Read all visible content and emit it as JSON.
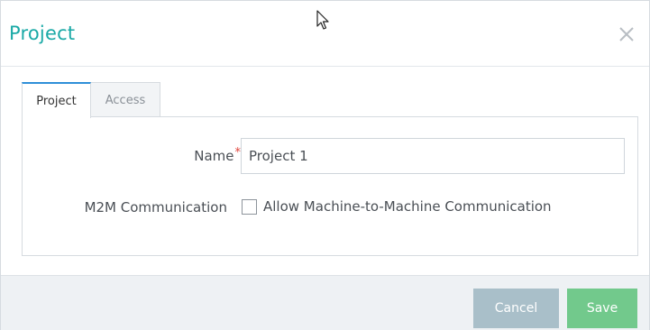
{
  "dialog": {
    "title": "Project",
    "close_icon": "close-icon"
  },
  "tabs": [
    {
      "label": "Project",
      "active": true
    },
    {
      "label": "Access",
      "active": false
    }
  ],
  "form": {
    "name_label": "Name",
    "required_marker": "*",
    "name_value": "Project 1",
    "m2m_label": "M2M Communication",
    "m2m_checkbox_label": "Allow Machine-to-Machine Communication",
    "m2m_checked": false
  },
  "footer": {
    "cancel_label": "Cancel",
    "save_label": "Save"
  },
  "colors": {
    "title": "#1aa9a6",
    "active_tab_border": "#2f8fd8",
    "required": "#e0443c",
    "cancel_button": "#a9bfc9",
    "save_button": "#72c98c",
    "footer_bg": "#eef1f4"
  }
}
